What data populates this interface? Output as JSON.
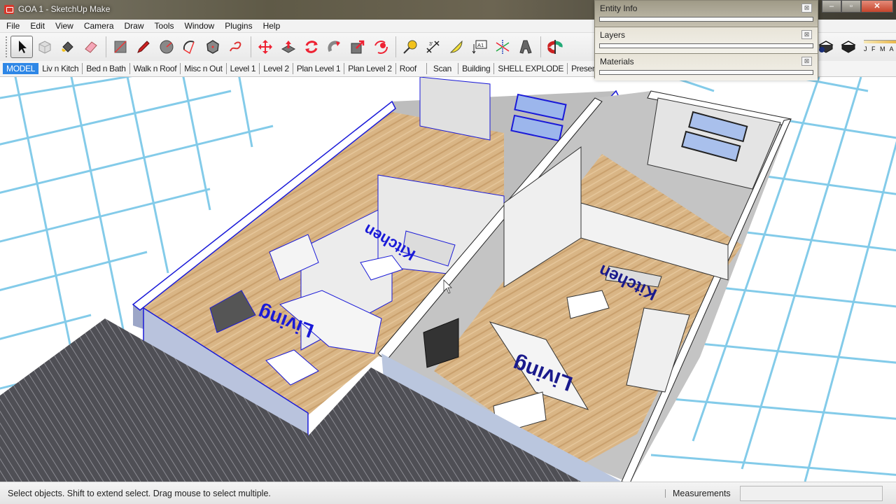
{
  "window": {
    "title": "GOA 1 - SketchUp Make",
    "controls": {
      "minimize": "–",
      "maximize": "▫",
      "close": "✕"
    }
  },
  "menu": [
    "File",
    "Edit",
    "View",
    "Camera",
    "Draw",
    "Tools",
    "Window",
    "Plugins",
    "Help"
  ],
  "toolbar": {
    "tools": [
      {
        "name": "select-tool",
        "icon": "arrow-cursor-icon",
        "active": true
      },
      {
        "name": "make-component-tool",
        "icon": "component-icon"
      },
      {
        "name": "paint-bucket-tool",
        "icon": "paint-bucket-icon"
      },
      {
        "name": "eraser-tool",
        "icon": "eraser-icon"
      },
      {
        "name": "rectangle-tool",
        "icon": "rectangle-icon"
      },
      {
        "name": "line-tool",
        "icon": "pencil-icon"
      },
      {
        "name": "circle-tool",
        "icon": "circle-icon"
      },
      {
        "name": "arc-tool",
        "icon": "arc-icon"
      },
      {
        "name": "polygon-tool",
        "icon": "polygon-icon"
      },
      {
        "name": "freehand-tool",
        "icon": "freehand-icon"
      },
      {
        "name": "move-tool",
        "icon": "move-icon"
      },
      {
        "name": "push-pull-tool",
        "icon": "push-pull-icon"
      },
      {
        "name": "rotate-tool",
        "icon": "rotate-icon"
      },
      {
        "name": "follow-me-tool",
        "icon": "follow-me-icon"
      },
      {
        "name": "scale-tool",
        "icon": "scale-icon"
      },
      {
        "name": "offset-tool",
        "icon": "offset-icon"
      },
      {
        "name": "tape-measure-tool",
        "icon": "tape-measure-icon"
      },
      {
        "name": "dimension-tool",
        "icon": "dimension-icon"
      },
      {
        "name": "protractor-tool",
        "icon": "protractor-icon"
      },
      {
        "name": "text-tool",
        "icon": "text-label-icon",
        "label": "A1"
      },
      {
        "name": "axes-tool",
        "icon": "axes-icon"
      },
      {
        "name": "3d-text-tool",
        "icon": "3d-text-icon"
      },
      {
        "name": "orbit-tool",
        "icon": "orbit-icon"
      }
    ],
    "shadow_months": "J F M A"
  },
  "scenes": {
    "tabs": [
      "MODEL",
      "Liv n Kitch",
      "Bed n Bath",
      "Walk n Roof",
      "Misc n Out",
      "Level 1",
      "Level 2",
      "Plan Level 1",
      "Plan Level 2",
      "Roof",
      "Scan",
      "Building",
      "SHELL EXPLODE",
      "Present"
    ],
    "active": "MODEL"
  },
  "trays": [
    {
      "title": "Entity Info"
    },
    {
      "title": "Layers"
    },
    {
      "title": "Materials"
    }
  ],
  "viewport": {
    "room_labels": [
      {
        "text": "Living",
        "model": "left"
      },
      {
        "text": "Kitchen",
        "model": "left"
      },
      {
        "text": "Living",
        "model": "right"
      },
      {
        "text": "Kitchen",
        "model": "right"
      }
    ],
    "colors": {
      "grid": "#5fb8e0",
      "selection": "#1a1ad8",
      "floor": "#d8b27f",
      "wall": "#c8c8c8",
      "deck": "#555555"
    }
  },
  "statusbar": {
    "message": "Select objects. Shift to extend select. Drag mouse to select multiple.",
    "measurements_label": "Measurements",
    "measurements_value": ""
  }
}
